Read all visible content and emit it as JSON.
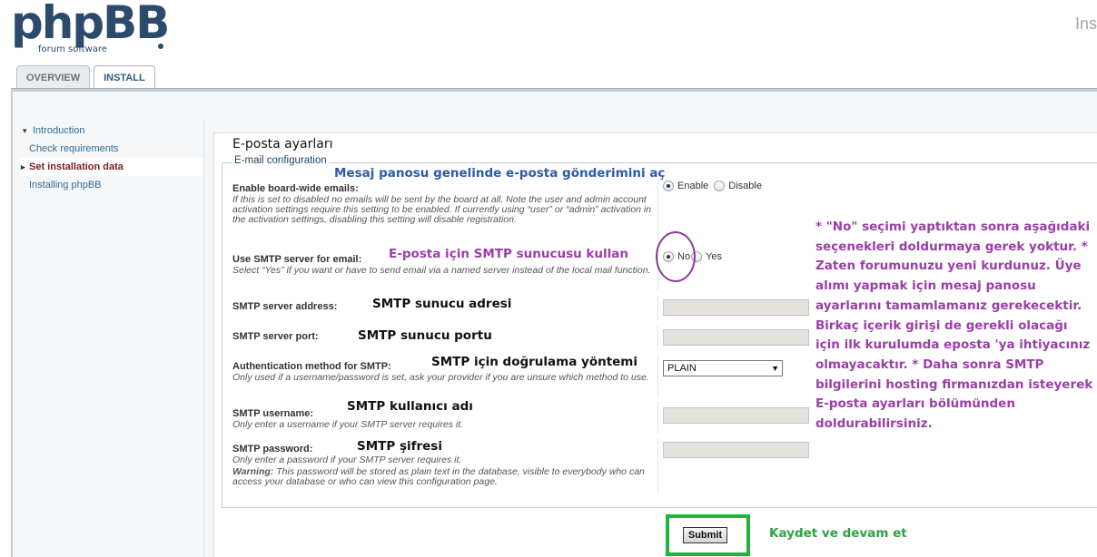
{
  "header": {
    "logo_main": "phpBB",
    "logo_sub": "forum software",
    "top_right_text": "Ins"
  },
  "tabs": [
    {
      "label": "OVERVIEW",
      "active": false
    },
    {
      "label": "INSTALL",
      "active": true
    }
  ],
  "sidebar": {
    "items": [
      {
        "label": "Introduction"
      },
      {
        "label": "Check requirements"
      },
      {
        "label": "Set installation data"
      },
      {
        "label": "Installing phpBB"
      }
    ]
  },
  "main": {
    "title": "E-posta ayarları",
    "legend": "E-mail configuration",
    "fields": {
      "board_email": {
        "label": "Enable board-wide emails:",
        "desc": "If this is set to disabled no emails will be sent by the board at all. Note the user and admin account activation settings require this setting to be enabled. If currently using “user” or “admin” activation in the activation settings, disabling this setting will disable registration.",
        "options": [
          "Enable",
          "Disable"
        ],
        "selected": "Enable"
      },
      "smtp": {
        "label": "Use SMTP server for email:",
        "desc": "Select “Yes” if you want or have to send email via a named server instead of the local mail function.",
        "options": [
          "No",
          "Yes"
        ],
        "selected": "No"
      },
      "smtp_address": {
        "label": "SMTP server address:",
        "value": ""
      },
      "smtp_port": {
        "label": "SMTP server port:",
        "value": ""
      },
      "smtp_auth": {
        "label": "Authentication method for SMTP:",
        "desc": "Only used if a username/password is set, ask your provider if you are unsure which method to use.",
        "selected": "PLAIN"
      },
      "smtp_user": {
        "label": "SMTP username:",
        "desc": "Only enter a username if your SMTP server requires it.",
        "value": ""
      },
      "smtp_pass": {
        "label": "SMTP password:",
        "desc": "Only enter a password if your SMTP server requires it.",
        "warning_label": "Warning:",
        "warning": "This password will be stored as plain text in the database, visible to everybody who can access your database or who can view this configuration page.",
        "value": ""
      }
    },
    "submit_label": "Submit"
  },
  "annotations": {
    "board_email": "Mesaj panosu genelinde e-posta gönderimini aç",
    "smtp": "E-posta için SMTP sunucusu kullan",
    "smtp_address": "SMTP sunucu adresi",
    "smtp_port": "SMTP sunucu portu",
    "smtp_auth": "SMTP için doğrulama yöntemi",
    "smtp_user": "SMTP kullanıcı adı",
    "smtp_pass": "SMTP şifresi",
    "note": "* \"No\" seçimi yaptıktan sonra aşağıdaki seçenekleri doldurmaya gerek yoktur. * Zaten forumunuzu yeni kurdunuz. Üye alımı yapmak için mesaj panosu ayarlarını tamamlamanız gerekecektir. Birkaç içerik girişi de gerekli olacağı için ilk kurulumda eposta 'ya ihtiyacınız olmayacaktır. * Daha sonra SMTP bilgilerini hosting firmanızdan isteyerek E-posta ayarları bölümünden doldurabilirsiniz.",
    "submit": "Kaydet ve devam et"
  },
  "colors": {
    "logo": "#2c4a6b",
    "link": "#2d6a98",
    "active_link": "#7a1e1e",
    "annotation_purple": "#9b3ea8",
    "annotation_blue": "#2e5aa7",
    "annotation_green": "#2ea141",
    "submit_frame": "#22b33a"
  }
}
